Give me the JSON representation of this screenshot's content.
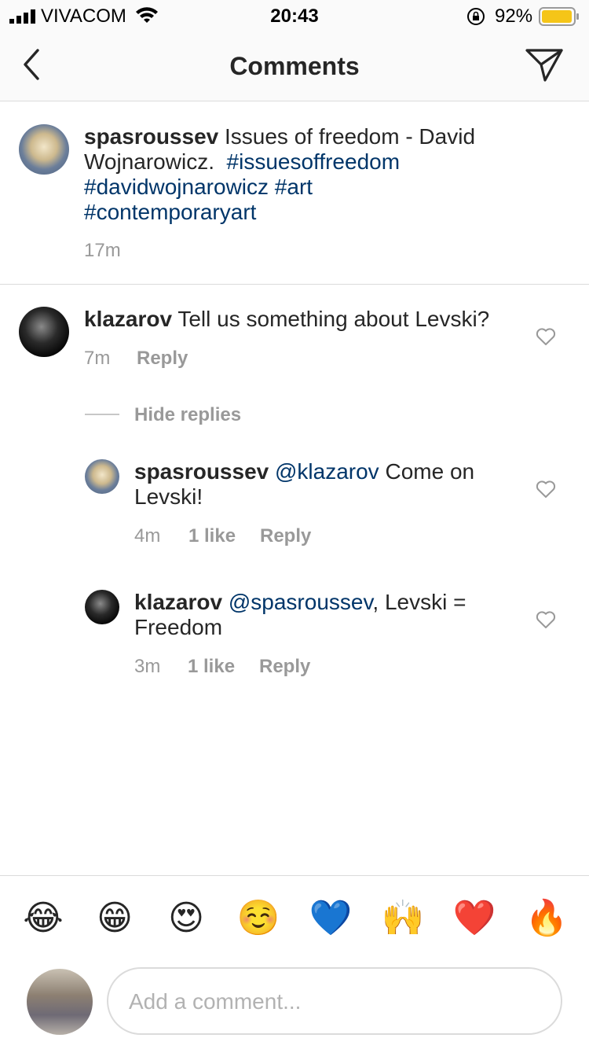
{
  "status_bar": {
    "carrier": "VIVACOM",
    "time": "20:43",
    "battery": "92%"
  },
  "nav": {
    "title": "Comments"
  },
  "caption": {
    "username": "spasroussev",
    "text": "Issues of freedom - David Wojnarowicz.",
    "hashtags": [
      "#issuesoffreedom",
      "#davidwojnarowicz",
      "#art",
      "#contemporaryart"
    ],
    "time": "17m"
  },
  "comments": [
    {
      "username": "klazarov",
      "text": "Tell us something about Levski?",
      "time": "7m",
      "reply_label": "Reply"
    }
  ],
  "hide_replies_label": "Hide replies",
  "replies": [
    {
      "username": "spasroussev",
      "mention": "@klazarov",
      "text": "Come on Levski!",
      "time": "4m",
      "likes": "1 like",
      "reply_label": "Reply"
    },
    {
      "username": "klazarov",
      "mention": "@spasroussev",
      "text": ", Levski = Freedom",
      "time": "3m",
      "likes": "1 like",
      "reply_label": "Reply"
    }
  ],
  "emoji_bar": [
    "😂",
    "😁",
    "😍",
    "☺️",
    "💙",
    "🙌",
    "❤️",
    "🔥"
  ],
  "composer": {
    "placeholder": "Add a comment..."
  },
  "colors": {
    "hashtag": "#003569",
    "meta": "#999999",
    "battery": "#f5c518"
  }
}
